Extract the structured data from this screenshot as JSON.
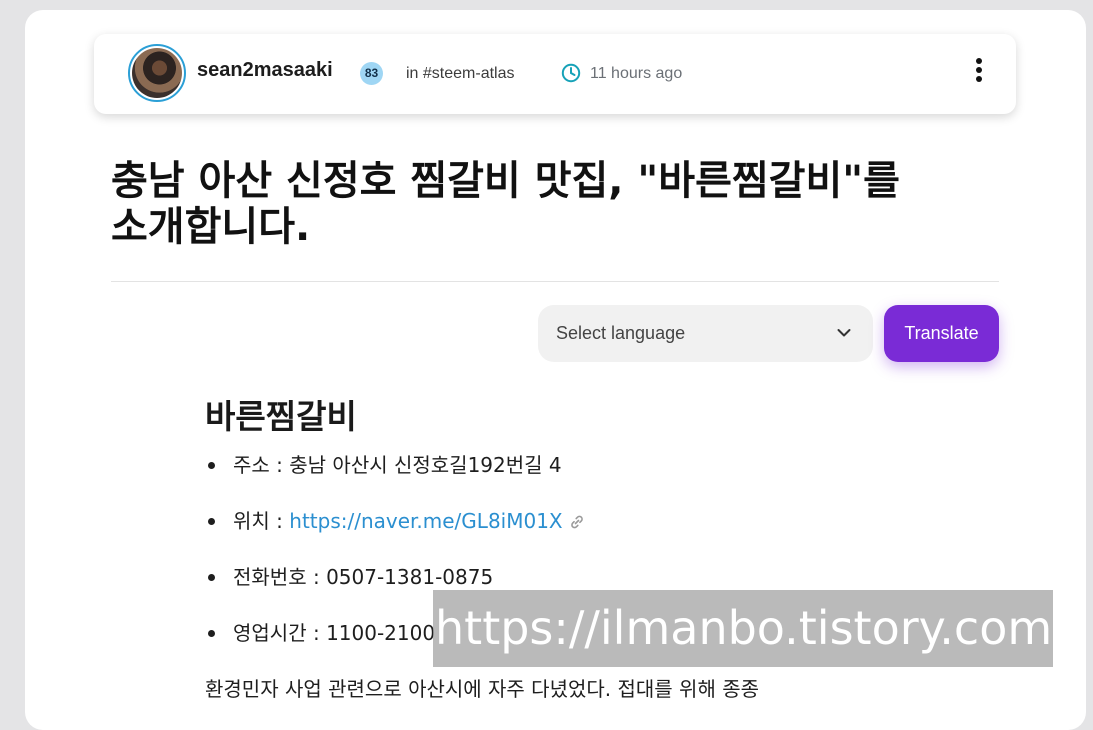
{
  "author": {
    "name": "sean2masaaki",
    "reputation": "83",
    "community": "in #steem-atlas",
    "timestamp": "11 hours ago"
  },
  "post": {
    "title": "충남 아산 신정호 찜갈비 맛집, \"바른찜갈비\"를 소개합니다."
  },
  "translate": {
    "select_label": "Select language",
    "button_label": "Translate"
  },
  "content": {
    "heading": "바른찜갈비",
    "items": [
      {
        "label": "주소 : ",
        "value": "충남 아산시 신정호길192번길 4"
      },
      {
        "label": "위치 : ",
        "value": "https://naver.me/GL8iM01X"
      },
      {
        "label": "전화번호 : ",
        "value": "0507-1381-0875"
      },
      {
        "label": "영업시간 : ",
        "value": "1100-2100"
      }
    ],
    "paragraph": "환경민자 사업 관련으로 아산시에 자주 다녔었다. 접대를 위해 종종"
  },
  "watermark": "https://ilmanbo.tistory.com",
  "colors": {
    "accent": "#7a2bd6",
    "link": "#2b8fd0",
    "reputation_badge": "#9fd6f4",
    "clock": "#17a2b8"
  },
  "icons": [
    "clock-icon",
    "more-vertical-icon",
    "chevron-down-icon",
    "link-icon"
  ]
}
